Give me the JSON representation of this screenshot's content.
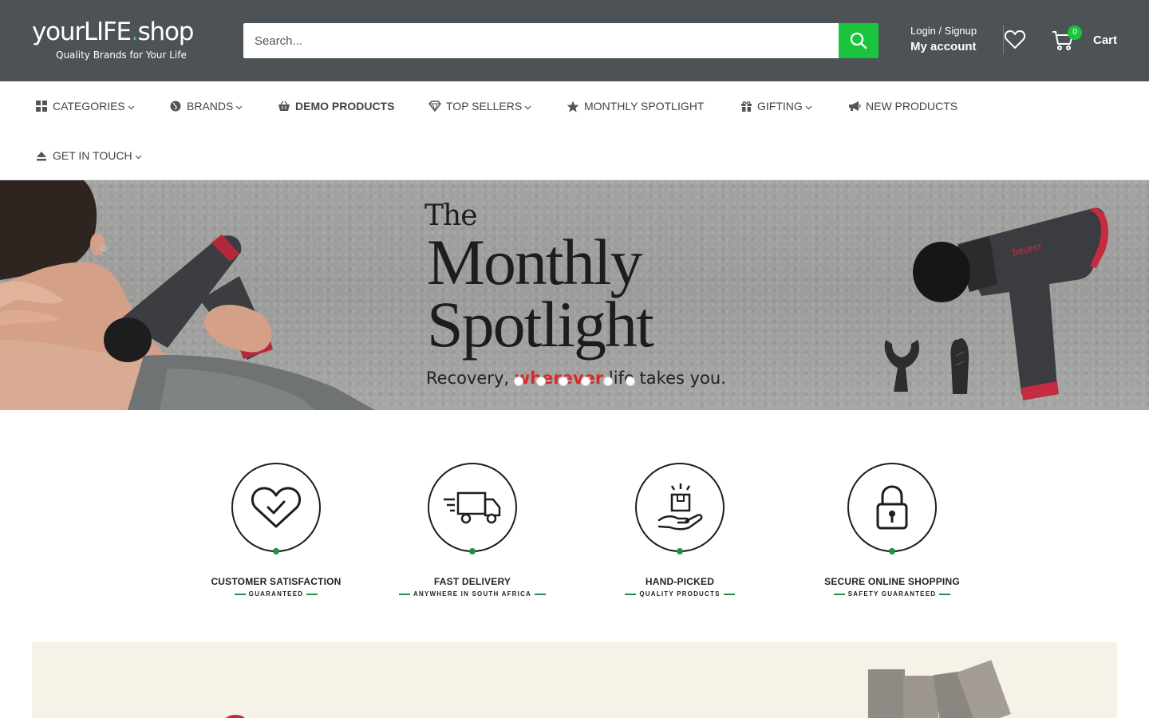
{
  "header": {
    "logo": {
      "brand_prefix": "yourLIFE",
      "dot": ".",
      "brand_suffix": "shop",
      "tagline": "Quality Brands for Your Life"
    },
    "search": {
      "placeholder": "Search...",
      "icon": "search-icon"
    },
    "account": {
      "login_label": "Login / Signup",
      "account_label": "My account"
    },
    "wishlist": {
      "icon": "heart-icon"
    },
    "cart": {
      "label": "Cart",
      "count": "0",
      "icon": "cart-icon"
    },
    "colors": {
      "background": "#4d5256",
      "accent": "#1bc43d"
    }
  },
  "nav": {
    "items": [
      {
        "label": "CATEGORIES",
        "icon": "grid-icon",
        "dropdown": true
      },
      {
        "label": "BRANDS",
        "icon": "globe-icon",
        "dropdown": true
      },
      {
        "label": "DEMO PRODUCTS",
        "icon": "basket-icon",
        "dropdown": false
      },
      {
        "label": "TOP SELLERS",
        "icon": "diamond-icon",
        "dropdown": true
      },
      {
        "label": "MONTHLY SPOTLIGHT",
        "icon": "star-icon",
        "dropdown": false
      },
      {
        "label": "GIFTING",
        "icon": "gift-icon",
        "dropdown": true
      },
      {
        "label": "NEW PRODUCTS",
        "icon": "megaphone-icon",
        "dropdown": false
      },
      {
        "label": "GET IN TOUCH",
        "icon": "eject-icon",
        "dropdown": true
      }
    ]
  },
  "hero": {
    "line1": "The",
    "line2": "Monthly",
    "line3": "Spotlight",
    "tagline_before": "Recovery, ",
    "tagline_highlight": "wherever",
    "tagline_after": " life takes you.",
    "product_brand": "beurer",
    "slide_count": 6,
    "active_slide": 1
  },
  "features": [
    {
      "title": "CUSTOMER SATISFACTION",
      "subtitle": "GUARANTEED",
      "icon": "heart-check-icon"
    },
    {
      "title": "FAST DELIVERY",
      "subtitle": "ANYWHERE IN SOUTH AFRICA",
      "icon": "truck-icon"
    },
    {
      "title": "HAND-PICKED",
      "subtitle": "QUALITY PRODUCTS",
      "icon": "hand-box-icon"
    },
    {
      "title": "SECURE ONLINE SHOPPING",
      "subtitle": "SAFETY GUARANTEED",
      "icon": "padlock-icon"
    }
  ]
}
